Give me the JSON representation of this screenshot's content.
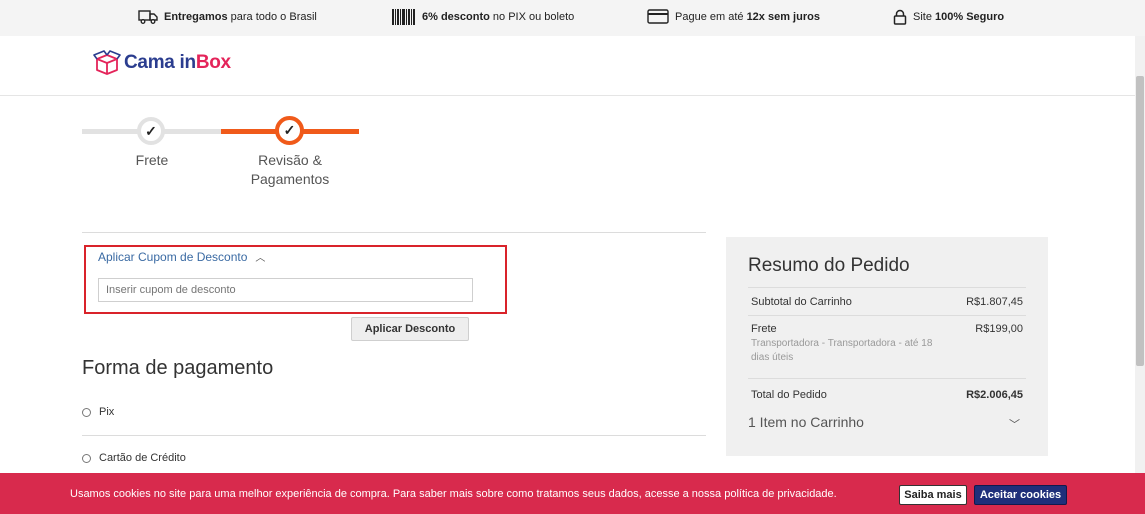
{
  "topbar": {
    "delivery": {
      "bold": "Entregamos",
      "rest": "para todo o Brasil",
      "icon": "truck-icon"
    },
    "discount": {
      "bold": "6% desconto",
      "rest": "no PIX ou boleto",
      "icon": "barcode-icon"
    },
    "installments": {
      "pre": "Pague em até",
      "bold": "12x sem juros",
      "icon": "credit-card-icon"
    },
    "secure": {
      "pre": "Site",
      "bold": "100% Seguro",
      "icon": "lock-icon"
    }
  },
  "logo": {
    "part1": "Cama ",
    "part2": "in",
    "part3": "Box"
  },
  "steps": [
    {
      "label": "Frete",
      "state": "done"
    },
    {
      "label": "Revisão & Pagamentos",
      "state": "active"
    }
  ],
  "coupon": {
    "toggle_label": "Aplicar Cupom de Desconto",
    "placeholder": "Inserir cupom de desconto",
    "apply_label": "Aplicar Desconto"
  },
  "payment": {
    "title": "Forma de pagamento",
    "options": [
      "Pix",
      "Cartão de Crédito"
    ]
  },
  "summary": {
    "title": "Resumo do Pedido",
    "subtotal_label": "Subtotal do Carrinho",
    "subtotal_value": "R$1.807,45",
    "shipping_label": "Frete",
    "shipping_value": "R$199,00",
    "shipping_desc": "Transportadora - Transportadora - até 18 dias úteis",
    "total_label": "Total do Pedido",
    "total_value": "R$2.006,45",
    "items_label": "1 Item no Carrinho"
  },
  "cookie": {
    "message": "Usamos cookies no site para uma melhor experiência de compra. Para saber mais sobre como tratamos seus dados, acesse a nossa política de privacidade.",
    "learn_more": "Saiba mais",
    "accept": "Aceitar cookies"
  },
  "colors": {
    "accent": "#f05a1a",
    "brand_blue": "#2b3d8f",
    "brand_pink": "#e4245a",
    "cookie_bg": "#d82a4d",
    "link": "#3a6aa3"
  }
}
